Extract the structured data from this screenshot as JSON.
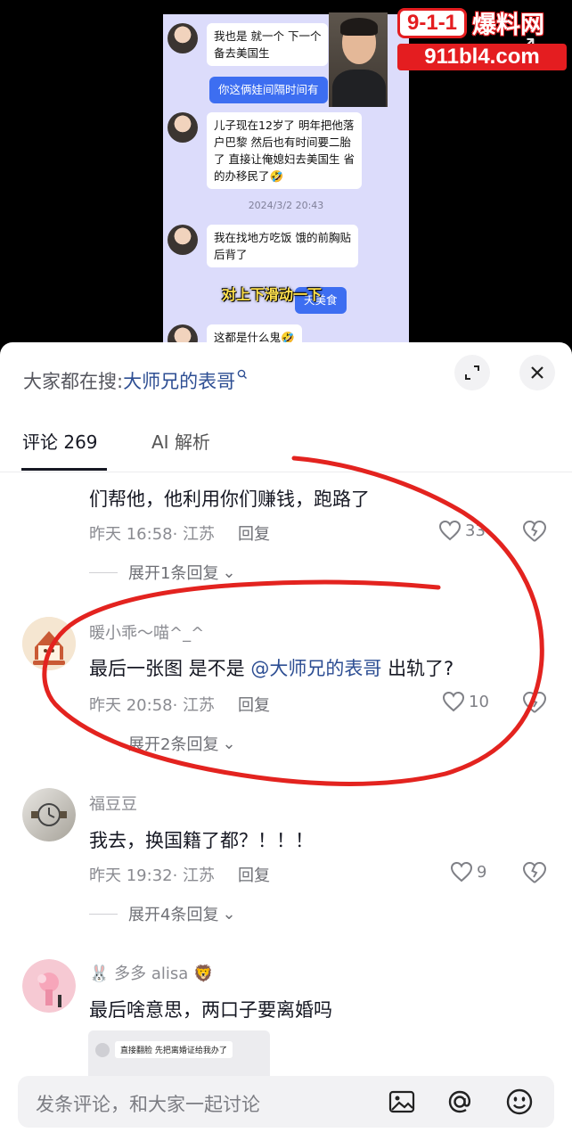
{
  "video": {
    "chat": {
      "msg1": [
        "我也是 就一个 下一个",
        "备去美国生"
      ],
      "msg2_right": "你这俩娃间隔时间有",
      "msg3": [
        "儿子现在12岁了 明年把他落",
        "户巴黎 然后也有时间要二胎",
        "了 直接让俺媳妇去美国生 省",
        "的办移民了🤣"
      ],
      "timestamp": "2024/3/2 20:43",
      "msg4": [
        "我在找地方吃饭 饿的前胸贴",
        "后背了"
      ],
      "msg5_right": "天美食",
      "msg6": "这都是什么鬼🤣"
    },
    "subtitle": "对上下滑动一下",
    "watermark": {
      "code": "9-1-1",
      "name": "爆料网",
      "domain": "911bl4.com"
    }
  },
  "search": {
    "prefix": "大家都在搜:",
    "term": "大师兄的表哥"
  },
  "tabs": {
    "comments": "评论 269",
    "ai": "AI 解析"
  },
  "comments": [
    {
      "text": "们帮他，他利用你们赚钱，跑路了",
      "meta": "昨天 16:58· 江苏",
      "reply": "回复",
      "likes": "33",
      "expand": "展开1条回复"
    },
    {
      "user": "暖小乖～喵^_^",
      "text_a": "最后一张图 是不是",
      "mention": "@大师兄的表哥",
      "text_b": "出轨了?",
      "meta": "昨天 20:58· 江苏",
      "reply": "回复",
      "likes": "10",
      "expand": "展开2条回复"
    },
    {
      "user": "福豆豆",
      "text": "我去，换国籍了都？！！！",
      "meta": "昨天 19:32· 江苏",
      "reply": "回复",
      "likes": "9",
      "expand": "展开4条回复"
    },
    {
      "user_prefix": "🐰",
      "user": "多多 alisa",
      "user_suffix": "🦁",
      "text": "最后啥意思，两口子要离婚吗",
      "image_text": "直接翻脸 先把离婚证给我办了"
    }
  ],
  "input": {
    "placeholder": "发条评论，和大家一起讨论"
  },
  "colors": {
    "annotation": "#e3231f",
    "mention": "#2d4e93",
    "chat_bg": "#dcdcfb",
    "chat_blue": "#3d6ef1"
  }
}
